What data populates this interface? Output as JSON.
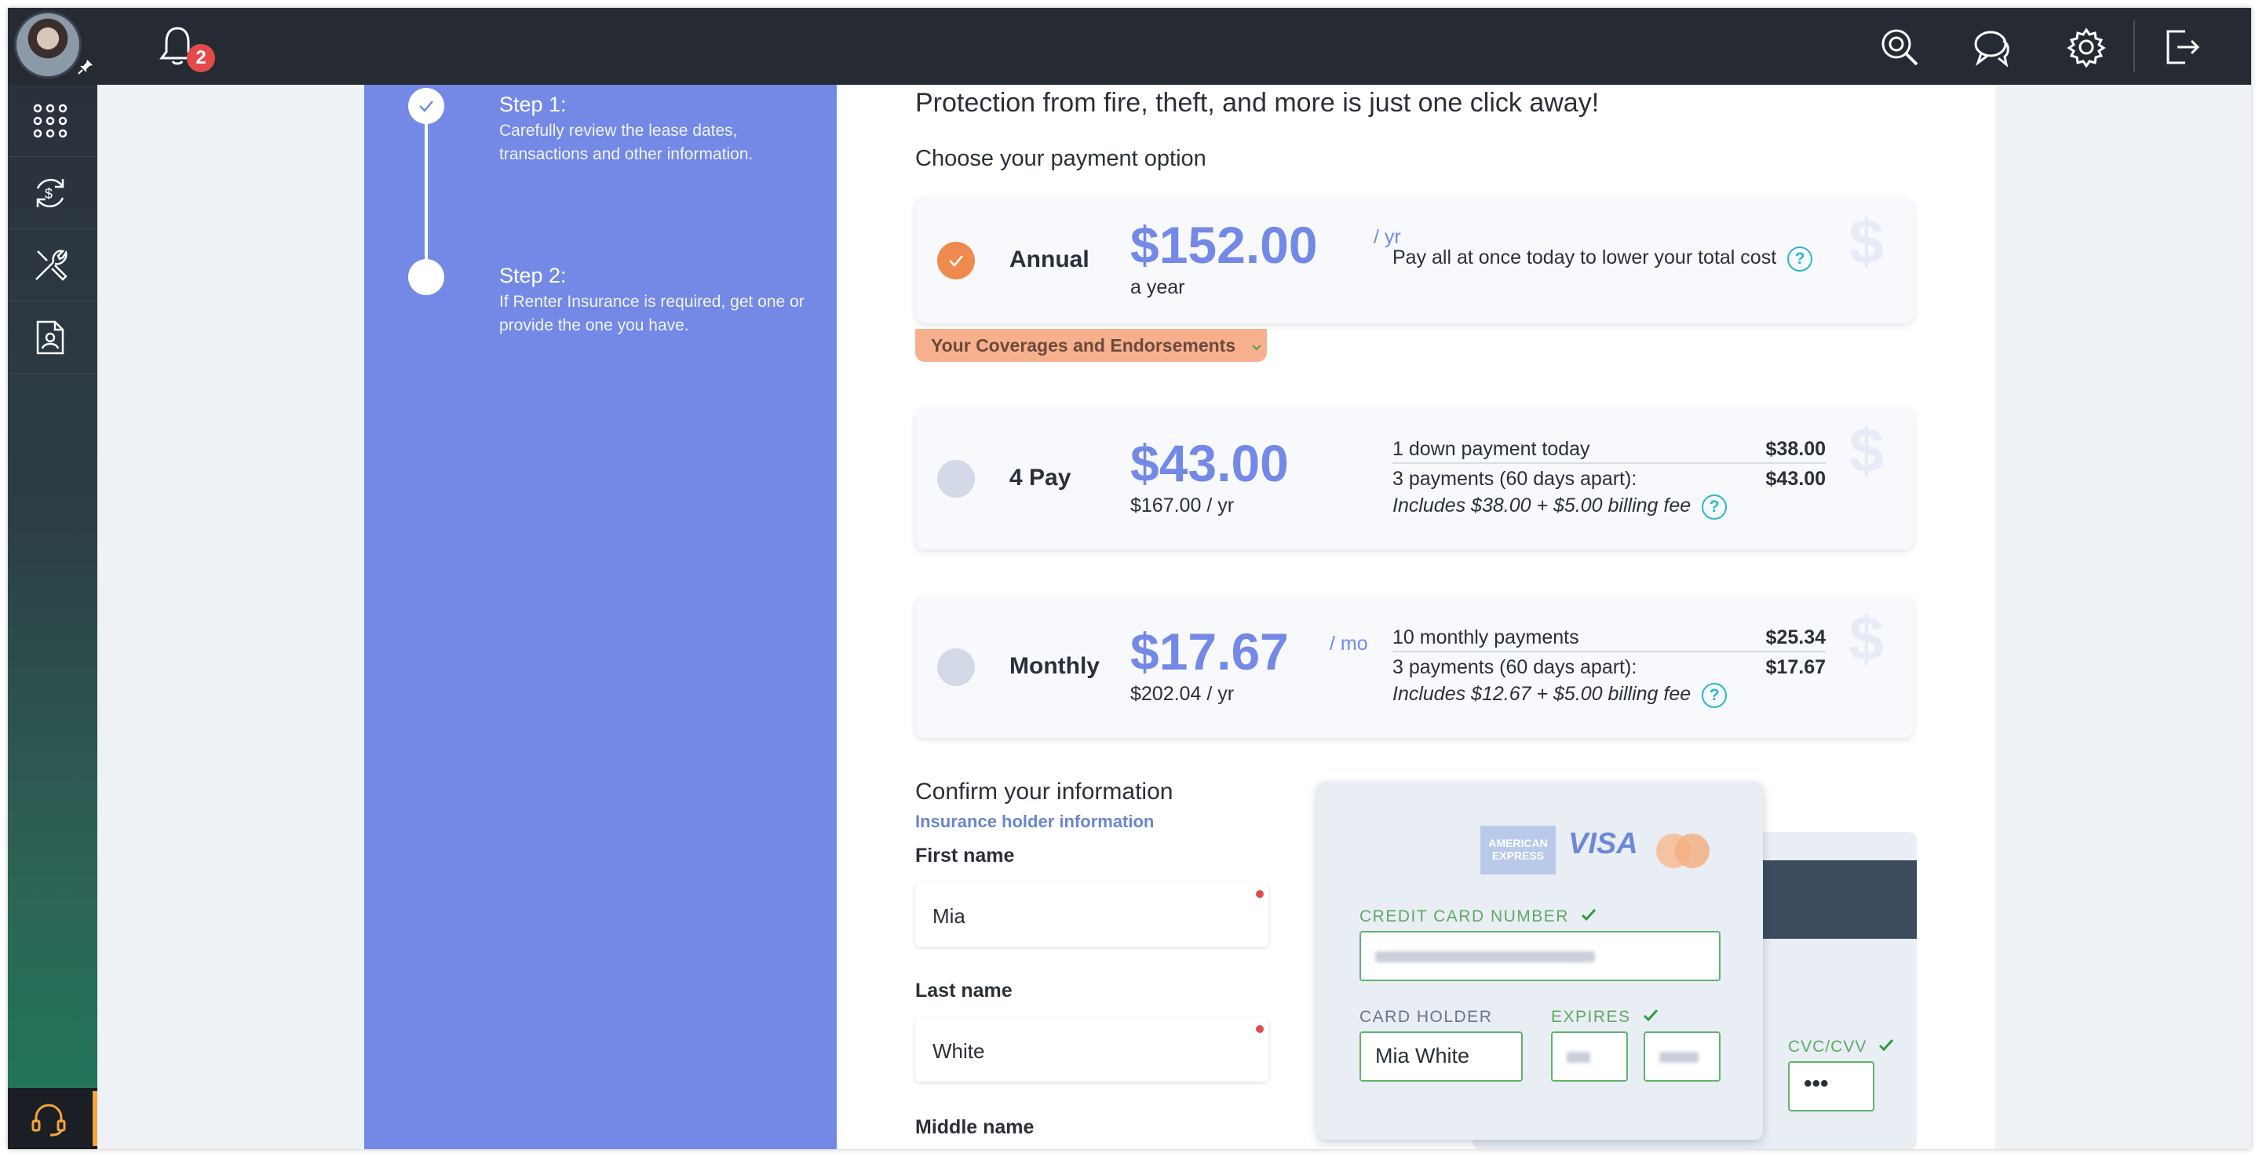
{
  "topbar": {
    "notifications_count": "2"
  },
  "steps": [
    {
      "title": "Step 1:",
      "desc": "Carefully review the lease dates, transactions and other information."
    },
    {
      "title": "Step 2:",
      "desc": "If Renter Insurance is required, get one or provide the one you have."
    }
  ],
  "main": {
    "heading": "Protection from fire, theft, and more is just one click away!",
    "subheading": "Choose your payment option",
    "coverages_tab": "Your Coverages and Endorsements"
  },
  "plans": [
    {
      "name": "Annual",
      "price": "$152.00",
      "unit": "/ yr",
      "sub": "a year",
      "note": "Pay all at once today to lower your total cost",
      "selected": true
    },
    {
      "name": "4 Pay",
      "price": "$43.00",
      "unit": "",
      "sub": "$167.00 / yr",
      "rows": [
        {
          "label": "1 down payment today",
          "amount": "$38.00"
        },
        {
          "label": "3 payments (60 days apart):",
          "amount": "$43.00"
        },
        {
          "label": "Includes $38.00 + $5.00 billing fee",
          "amount": ""
        }
      ]
    },
    {
      "name": "Monthly",
      "price": "$17.67",
      "unit": "/ mo",
      "sub": "$202.04 / yr",
      "rows": [
        {
          "label": "10 monthly payments",
          "amount": "$25.34"
        },
        {
          "label": "3 payments (60 days apart):",
          "amount": "$17.67"
        },
        {
          "label": "Includes $12.67 + $5.00 billing fee",
          "amount": ""
        }
      ]
    }
  ],
  "confirm": {
    "title": "Confirm your information",
    "subtitle": "Insurance holder information",
    "first_name_label": "First name",
    "first_name_value": "Mia",
    "last_name_label": "Last name",
    "last_name_value": "White",
    "middle_name_label": "Middle name"
  },
  "card": {
    "logo_amex": "AMERICAN EXPRESS",
    "logo_visa": "VISA",
    "number_label": "CREDIT CARD NUMBER",
    "holder_label": "CARD HOLDER",
    "holder_value": "Mia White",
    "expires_label": "EXPIRES",
    "cvc_label": "CVC/CVV",
    "cvc_value": "•••"
  },
  "colors": {
    "accent": "#7489e6",
    "selected": "#ef8a4e",
    "valid": "#5fb36a",
    "badge": "#e34b4b"
  }
}
